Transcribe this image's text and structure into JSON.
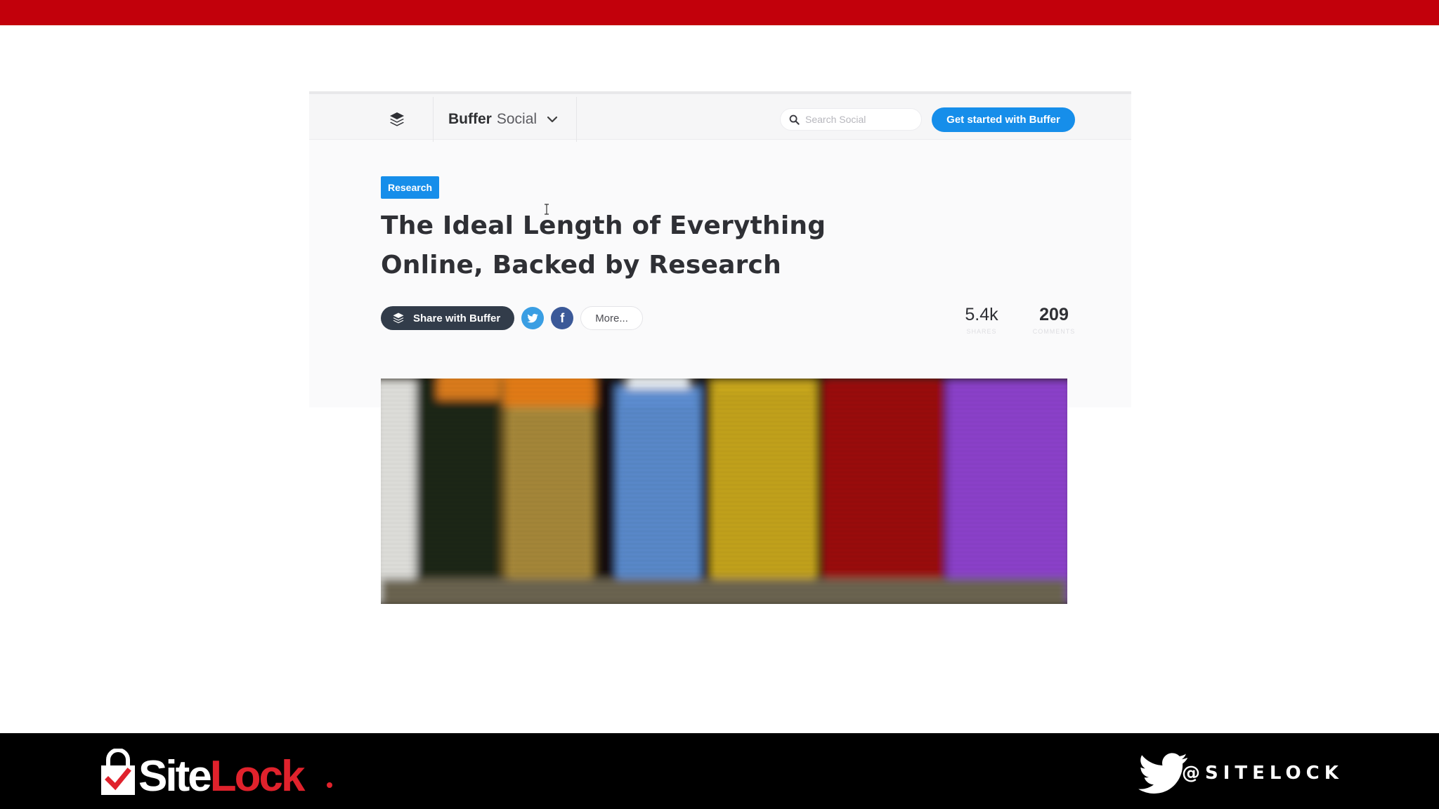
{
  "colors": {
    "top_bar": "#c2000b",
    "accent_blue": "#168eea",
    "dark_button": "#323c4a",
    "footer": "#000000",
    "brand_red": "#e0222c"
  },
  "nav": {
    "logo_icon": "buffer-stack-icon",
    "brand_bold": "Buffer",
    "brand_light": "Social",
    "dropdown_icon": "chevron-down-icon",
    "search_placeholder": "Search Social",
    "search_value": "",
    "cta_label": "Get started with Buffer"
  },
  "article": {
    "tag": "Research",
    "title": "The Ideal Length of Everything Online, Backed by Research",
    "share_label": "Share with Buffer",
    "facebook_glyph": "f",
    "more_label": "More...",
    "stats": [
      {
        "value": "5.4k",
        "label": "shares"
      },
      {
        "value": "209",
        "label": "comments"
      }
    ],
    "hero_image": "colorful-thread-spools-image"
  },
  "footer": {
    "logo_site": "Site",
    "logo_lock": "Lock",
    "twitter_icon": "twitter-bird-icon",
    "handle": "@SITELOCK"
  }
}
